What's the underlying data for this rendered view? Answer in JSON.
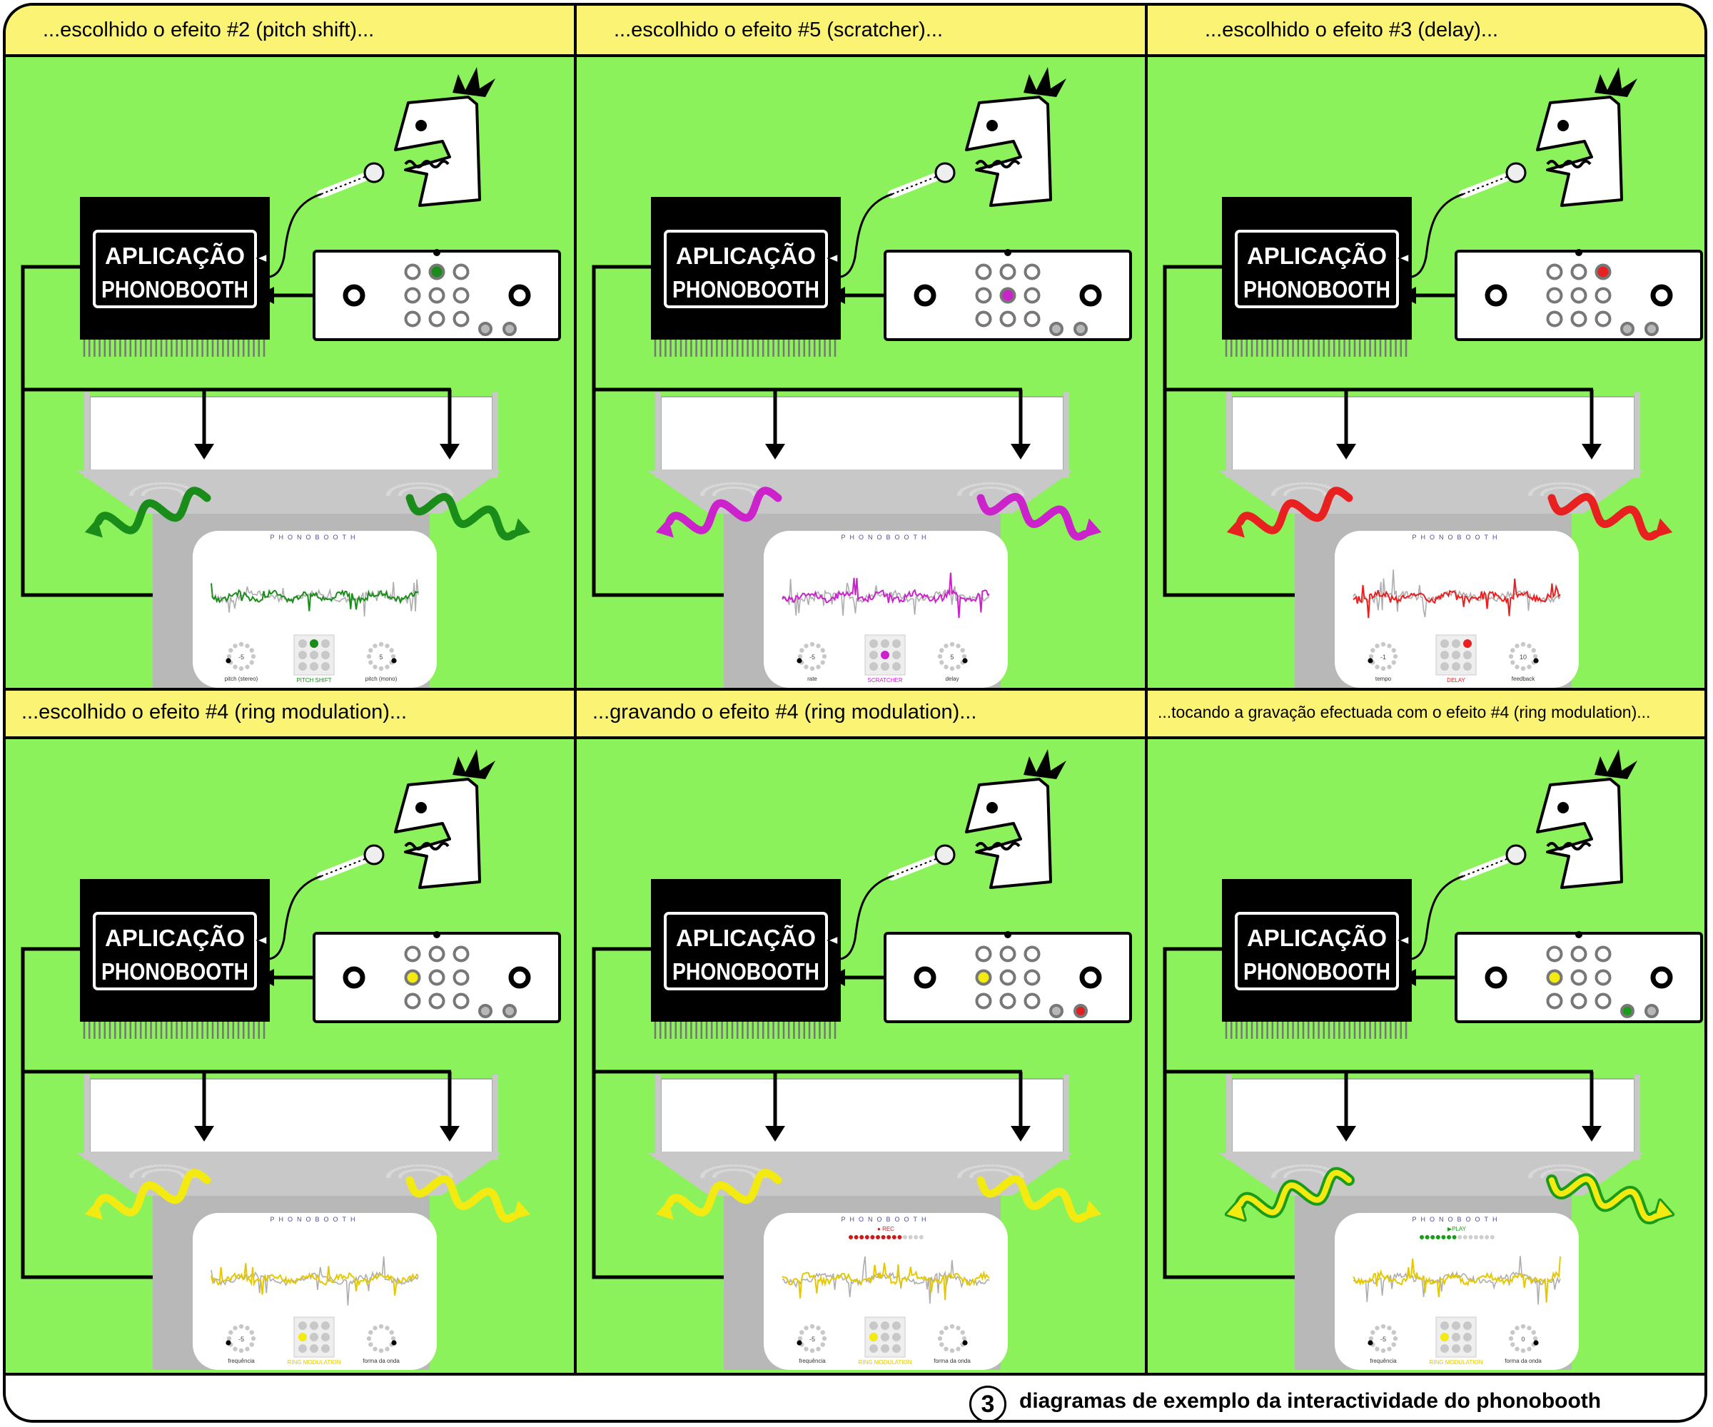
{
  "app_label_line1": "APLICAÇÃO",
  "app_label_line2": "PHONOBOOTH",
  "screen_title": "PHONOBOOTH",
  "panels": [
    {
      "caption": "...escolhido o efeito #2 (pitch shift)...",
      "color": "#1a8c1a",
      "outline": "",
      "selected_button": 1,
      "knob_left_value": "-5",
      "knob_right_value": "5",
      "knob_left_label": "pitch (stereo)",
      "knob_right_label": "pitch (mono)",
      "effect_label": "PITCH SHIFT",
      "control_led_left": "#b8b8b8",
      "control_led_right": "#b8b8b8",
      "status_text": ""
    },
    {
      "caption": "...escolhido o efeito #5 (scratcher)...",
      "color": "#cc22cc",
      "outline": "",
      "selected_button": 4,
      "knob_left_value": "-5",
      "knob_right_value": "5",
      "knob_left_label": "rate",
      "knob_right_label": "delay",
      "effect_label": "SCRATCHER",
      "control_led_left": "#b8b8b8",
      "control_led_right": "#b8b8b8",
      "status_text": ""
    },
    {
      "caption": "...escolhido o efeito #3 (delay)...",
      "color": "#e82020",
      "outline": "",
      "selected_button": 2,
      "knob_left_value": "-1",
      "knob_right_value": "10",
      "knob_left_label": "tempo",
      "knob_right_label": "feedback",
      "effect_label": "DELAY",
      "control_led_left": "#b8b8b8",
      "control_led_right": "#b8b8b8",
      "status_text": ""
    },
    {
      "caption": "...escolhido o efeito #4 (ring modulation)...",
      "color": "#f2ea10",
      "outline": "",
      "selected_button": 3,
      "knob_left_value": "-5",
      "knob_right_value": "",
      "knob_left_label": "frequência",
      "knob_right_label": "forma da onda",
      "effect_label": "RING MODULATION",
      "control_led_left": "#b8b8b8",
      "control_led_right": "#b8b8b8",
      "status_text": ""
    },
    {
      "caption": "...gravando o efeito #4 (ring modulation)...",
      "color": "#f2ea10",
      "outline": "",
      "selected_button": 3,
      "knob_left_value": "-5",
      "knob_right_value": "",
      "knob_left_label": "frequência",
      "knob_right_label": "forma da onda",
      "effect_label": "RING MODULATION",
      "control_led_left": "#b8b8b8",
      "control_led_right": "#e02020",
      "status_text": "● REC"
    },
    {
      "caption": "...tocando a gravação efectuada com o efeito #4 (ring modulation)...",
      "color": "#f2ea10",
      "outline": "#1a9c1a",
      "selected_button": 3,
      "knob_left_value": "-5",
      "knob_right_value": "0",
      "knob_left_label": "frequência",
      "knob_right_label": "forma da onda",
      "effect_label": "RING MODULATION",
      "control_led_left": "#1a9c1a",
      "control_led_right": "#b8b8b8",
      "status_text": "▶PLAY"
    }
  ],
  "footer": {
    "number": "3",
    "title": "diagramas de exemplo da interactividade do phonobooth"
  }
}
